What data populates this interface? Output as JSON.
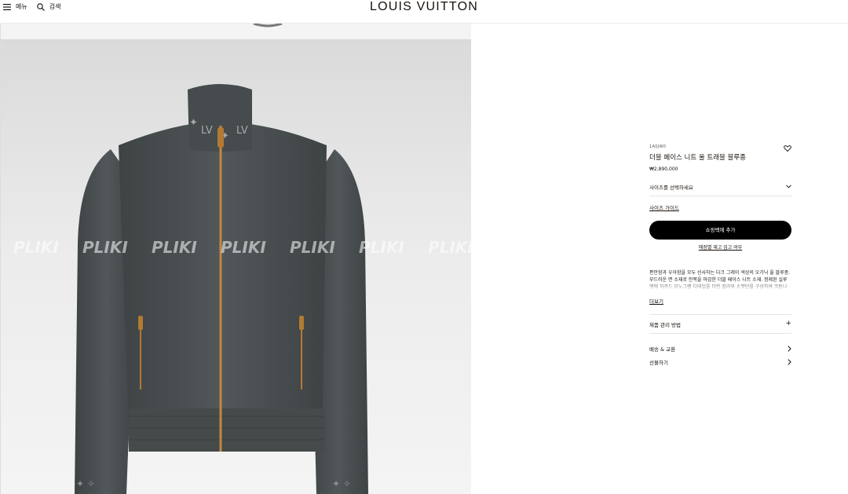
{
  "header": {
    "menu_label": "메뉴",
    "search_label": "검색",
    "logo": "LOUIS VUITTON"
  },
  "gallery": {
    "watermark": "PLIKI"
  },
  "product": {
    "sku": "1A0JW0",
    "title": "더블 페이스 니트 울 트래블 블루종",
    "price": "₩2,890,000",
    "size_select_label": "사이즈를 선택하세요",
    "size_guide_label": "사이즈 가이드",
    "add_to_cart_label": "쇼핑백에 추가",
    "store_availability_label": "매장별 재고 입고 여부",
    "description": "편안함과 우아함을 모두 선사하는 다크 그레이 색상의 오가닉 울 블루종. 부드러운 면 소재로 안쪽을 마감한 더블 페이스 니트 소재. 정제된 실루엣에 자카드 모노그램 디테일을 더한 칼라와 소맷단을 구성하여 코튼나 파킹 안에서도 돋보이는 디자인. 메탈릭 ...",
    "more_label": "더보기",
    "care_label": "제품 관리 방법",
    "shipping_label": "배송 & 교환",
    "gift_label": "선물하기"
  },
  "colors": {
    "jacket": "#4a4f50",
    "zipper": "#c0893f",
    "background": "#eaeaea"
  }
}
